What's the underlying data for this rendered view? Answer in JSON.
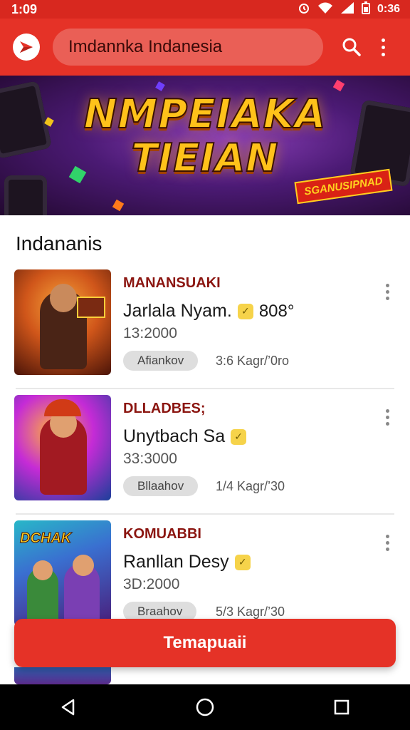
{
  "status_bar": {
    "time": "1:09",
    "right_time": "0:36",
    "icons": [
      "alarm-icon",
      "wifi-icon",
      "signal-icon",
      "battery-icon"
    ]
  },
  "app_bar": {
    "search_text": "Imdannka Indanesia",
    "icons": [
      "app-logo-icon",
      "search-icon",
      "more-vert-icon"
    ]
  },
  "banner": {
    "line1": "NMPEIAKA",
    "line2": "TIEIAN",
    "tag": "SGANUSIPNAD"
  },
  "section": {
    "title": "Indananis"
  },
  "items": [
    {
      "category": "MANANSUAKI",
      "title": "Jarlala Nyam.",
      "extra": "808°",
      "date": "13:2000",
      "badge": "Afiankov",
      "meta": "3:6 Kagr/’0ro",
      "thumb_label": "",
      "colors": {
        "bg1": "#f07a1c",
        "bg2": "#5b1a0a",
        "fig": "#4a2416"
      }
    },
    {
      "category": "DLLADBES;",
      "title": "Unytbach Sa",
      "extra": "",
      "date": "33:3000",
      "badge": "Bllaahov",
      "meta": "1/4 Kagr/’30",
      "thumb_label": "",
      "colors": {
        "bg1": "#c52bd6",
        "bg2": "#1b3f9a",
        "fig": "#a21a22"
      }
    },
    {
      "category": "KOMUABBI",
      "title": "Ranllan Desy",
      "extra": "",
      "date": "3D:2000",
      "badge": "Braahov",
      "meta": "5/3 Kagr/’30",
      "thumb_label": "DCHAK",
      "colors": {
        "bg1": "#28b7c8",
        "bg2": "#4a1d7a",
        "fig": "#7a3fb3"
      }
    }
  ],
  "cta": {
    "label": "Temapuaii"
  },
  "nav_bar": {
    "icons": [
      "back-icon",
      "home-icon",
      "recents-icon"
    ]
  },
  "colors": {
    "primary": "#e53227",
    "status": "#d8281f",
    "category": "#8b1510"
  }
}
